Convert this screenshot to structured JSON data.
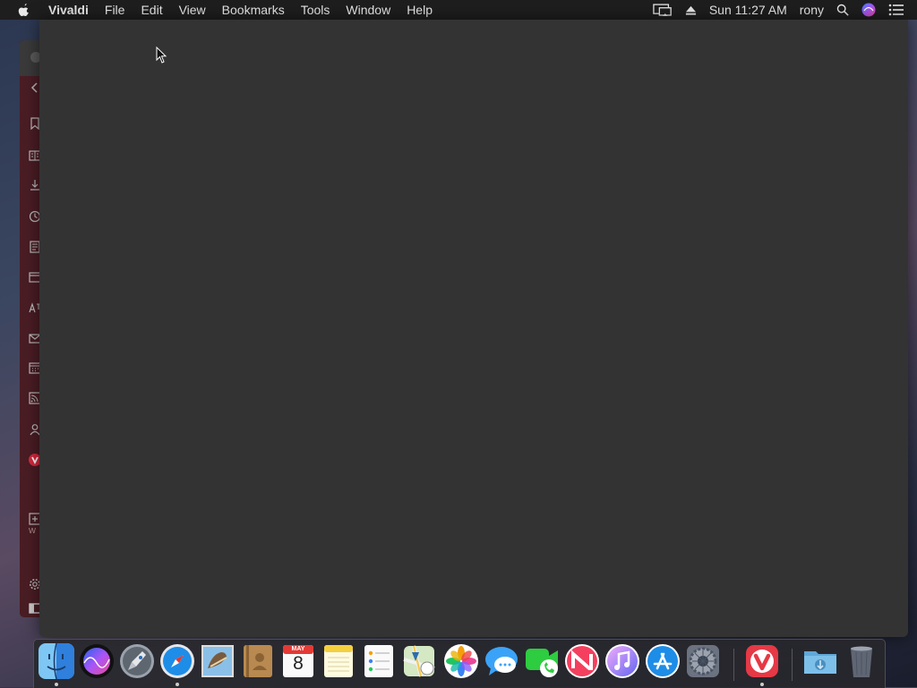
{
  "menubar": {
    "app_name": "Vivaldi",
    "items": [
      "File",
      "Edit",
      "View",
      "Bookmarks",
      "Tools",
      "Window",
      "Help"
    ],
    "clock": "Sun 11:27 AM",
    "user": "rony"
  },
  "side_panel": {
    "icons": [
      "bookmarks-icon",
      "reading-list-icon",
      "downloads-icon",
      "history-icon",
      "notes-icon",
      "window-icon",
      "translate-icon",
      "mail-icon",
      "calendar-icon",
      "feeds-icon",
      "contacts-icon",
      "vivaldi-icon",
      "add-panel-icon",
      "settings-icon",
      "panel-toggle-icon"
    ],
    "text": "w"
  },
  "dock": {
    "calendar_month": "MAY",
    "calendar_day": "8",
    "apps": [
      "Finder",
      "Siri",
      "Launchpad",
      "Safari",
      "Mail",
      "Contacts",
      "Calendar",
      "Notes",
      "Reminders",
      "Maps",
      "Photos",
      "Messages",
      "FaceTime",
      "News",
      "iTunes",
      "App Store",
      "System Preferences",
      "Vivaldi",
      "Downloads",
      "Trash"
    ]
  },
  "colors": {
    "menubar_bg": "#1e1e1f",
    "window_bg": "#333334",
    "panel_bg": "#4a1d24",
    "vivaldi_red": "#d8293f"
  }
}
